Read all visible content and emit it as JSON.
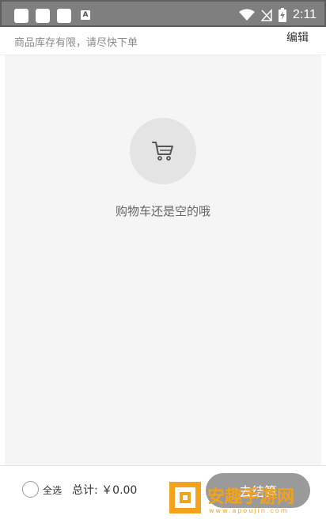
{
  "status_bar": {
    "time": "2:11",
    "keyboard_indicator": "A",
    "icons": [
      "notification-square-icon",
      "notification-square-icon",
      "notification-square-icon",
      "keyboard-a-icon",
      "wifi-icon",
      "no-signal-icon",
      "battery-charging-icon"
    ]
  },
  "header": {
    "hint": "商品库存有限，请尽快下单",
    "edit_label": "编辑"
  },
  "empty_state": {
    "icon": "shopping-cart-icon",
    "message": "购物车还是空的哦"
  },
  "footer": {
    "select_all_label": "全选",
    "total_label": "总计:",
    "total_value": "￥0.00",
    "checkout_label": "去结算"
  },
  "colors": {
    "status_bar": "#7f7f7f",
    "content_bg": "#f5f5f5",
    "checkout_bg": "#9a9a9a",
    "watermark_orange": "#f3a21b"
  },
  "watermark": {
    "text": "安趣手游网",
    "url": "www.apoujin.com"
  }
}
